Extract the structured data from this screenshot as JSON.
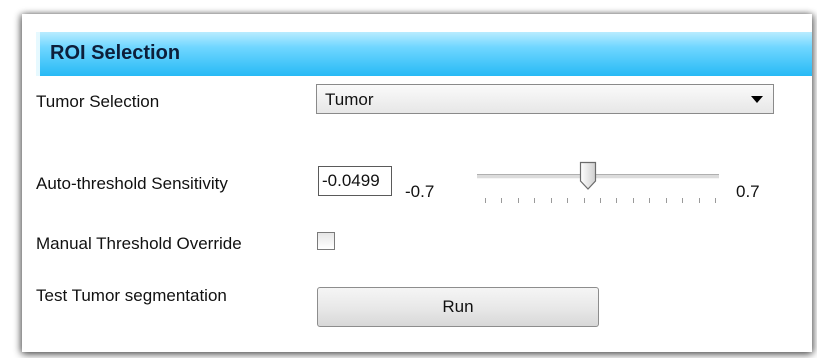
{
  "section": {
    "title": "ROI Selection"
  },
  "tumor_selection": {
    "label": "Tumor Selection",
    "value": "Tumor"
  },
  "auto_threshold": {
    "label": "Auto-threshold Sensitivity",
    "value": "-0.0499",
    "min_label": "-0.7",
    "max_label": "0.7",
    "slider_fraction": 0.46
  },
  "manual_override": {
    "label": "Manual Threshold Override",
    "checked": false
  },
  "test_segmentation": {
    "label": "Test Tumor segmentation",
    "button_label": "Run"
  },
  "colors": {
    "header_accent": "#27baf5"
  }
}
